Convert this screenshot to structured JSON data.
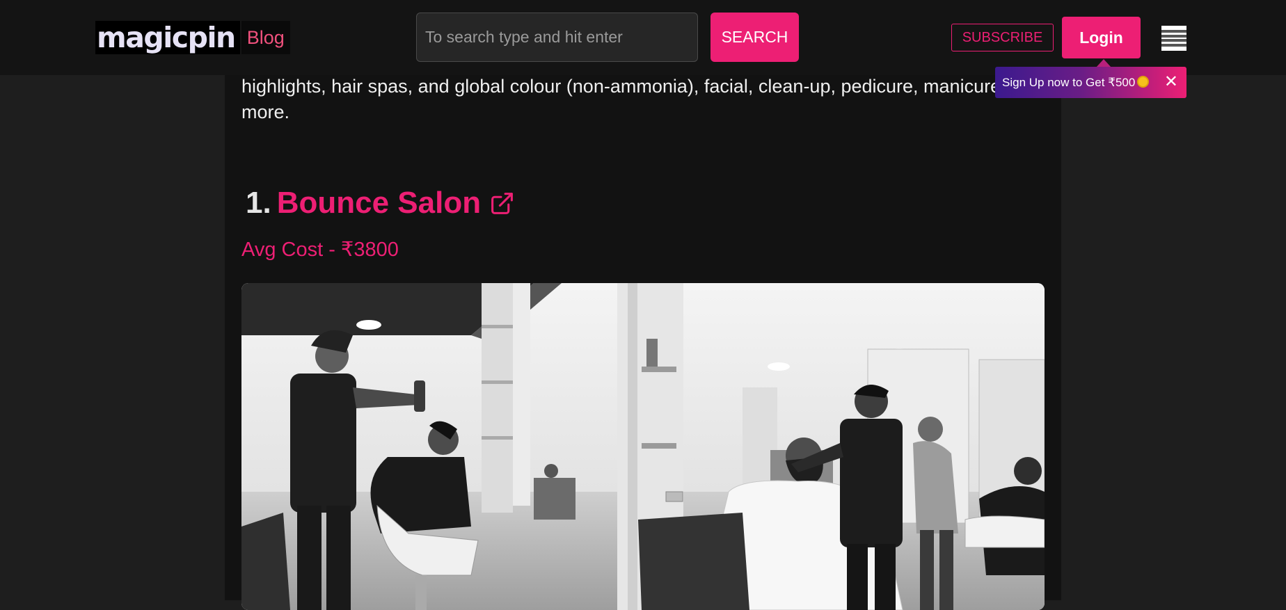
{
  "header": {
    "logo_text": "magicpin",
    "logo_blog_label": "Blog",
    "search_placeholder": "To search type and hit enter",
    "search_button_label": "SEARCH",
    "subscribe_label": "SUBSCRIBE",
    "login_label": "Login",
    "menu_icon": "hamburger-menu-icon"
  },
  "signup_banner": {
    "text": "Sign Up now to Get ₹500",
    "coin_icon": "coin-icon",
    "close_label": "✕"
  },
  "article": {
    "intro_text": "highlights, hair spas, and global colour (non-ammonia), facial, clean-up, pedicure, manicure, and more.",
    "salon": {
      "number": "1.",
      "name": "Bounce Salon",
      "link_icon": "external-link-icon",
      "avg_cost": "Avg Cost - ₹3800",
      "photo": "salon-interior-photo"
    }
  },
  "colors": {
    "accent": "#ed1f74",
    "header_bg": "#141414",
    "content_bg": "#121212",
    "page_bg": "#1e1e1e"
  }
}
